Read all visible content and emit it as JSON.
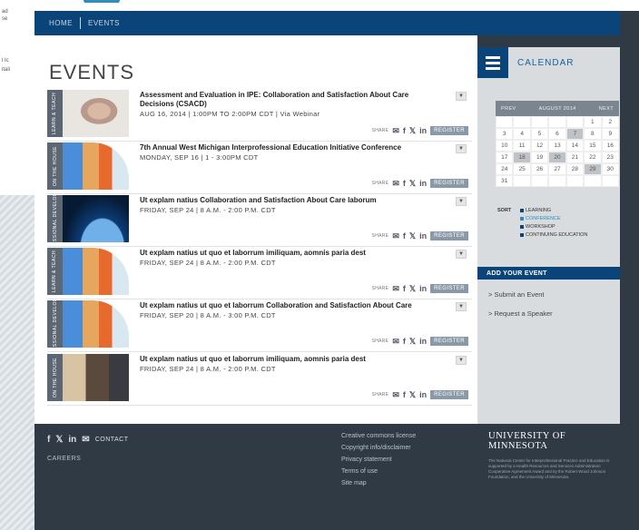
{
  "nav": {
    "items": [
      "HOME",
      "EVENTS"
    ]
  },
  "left_panel": {
    "lines": [
      "ad",
      "se",
      "l Ic",
      "itali"
    ]
  },
  "page": {
    "title": "EVENTS"
  },
  "share_label": "SHARE",
  "register_label": "REGISTER",
  "events": [
    {
      "band": "LEARN & TEACH",
      "image": "face",
      "title": "Assessment and Evaluation in IPE: Collaboration and Satisfaction About Care Decisions (CSACD)",
      "date": "AUG 16, 2014   |   1:00PM TO 2:00PM CDT   |   Via Webinar"
    },
    {
      "band": "ON THE HOUSE",
      "image": "arcs",
      "title": "7th Annual West Michigan Interprofessional Education Initiative Conference",
      "date": "MONDAY, SEP 16   |   1 - 3:00PM CDT"
    },
    {
      "band": "PROFESSIONAL DEVELOPMENT",
      "image": "earth",
      "title": "Ut explam natius Collaboration and Satisfaction About Care laborum",
      "date": "FRIDAY, SEP 24   |   8 A.M. - 2:00 P.M. CDT"
    },
    {
      "band": "LEARN & TEACH",
      "image": "arcs",
      "title": "Ut explam natius ut quo et laborrum imiliquam, aomnis paria dest",
      "date": "FRIDAY, SEP 24   |   8 A.M. - 2:00 P.M. CDT"
    },
    {
      "band": "PROFESSIONAL DEVELOPMENT",
      "image": "arcs",
      "title": "Ut explam natius ut quo et laborrum Collaboration and Satisfaction About Care",
      "date": "FRIDAY, SEP 20   |   8 A.M. - 3:00 P.M. CDT"
    },
    {
      "band": "ON THE HOUSE",
      "image": "people",
      "title": "Ut explam natius ut quo et laborrum imiliquam, aomnis paria dest",
      "date": "FRIDAY, SEP 24   |   8 A.M. - 2:00 P.M. CDT"
    }
  ],
  "calendar": {
    "title": "CALENDAR",
    "prev": "PREV",
    "month": "AUGUST 2014",
    "next": "NEXT",
    "days": [
      "",
      "",
      "",
      "",
      "",
      "1",
      "2",
      "3",
      "4",
      "5",
      "6",
      "7",
      "8",
      "9",
      "10",
      "11",
      "12",
      "13",
      "14",
      "15",
      "16",
      "17",
      "18",
      "19",
      "20",
      "21",
      "22",
      "23",
      "24",
      "25",
      "26",
      "27",
      "28",
      "29",
      "30",
      "31",
      "",
      "",
      "",
      "",
      "",
      ""
    ],
    "highlighted": [
      "7",
      "18",
      "20",
      "29"
    ],
    "legend_key": "SORT",
    "legend": [
      {
        "label": "LEARNING",
        "color": "#0a4478"
      },
      {
        "label": "CONFERENCE",
        "color": "#2a8fc0"
      },
      {
        "label": "WORKSHOP",
        "color": "#0a4478"
      },
      {
        "label": "CONTINUING EDUCATION",
        "color": "#0a4478"
      }
    ],
    "legend_colors": {
      "learning": "#0a4478",
      "conference": "#2a8fc0"
    }
  },
  "sidebar": {
    "add_event": "ADD YOUR EVENT",
    "links": [
      "> Submit an Event",
      "> Request a Speaker"
    ]
  },
  "footer": {
    "contact": "CONTACT",
    "careers": "CAREERS",
    "links": [
      "Creative commons license",
      "Copyright info/disclaimer",
      "Privacy statement",
      "Terms of use",
      "Site map"
    ],
    "university": "UNIVERSITY OF MINNESOTA",
    "disclaimer": "The National Center for Interprofessional Practice and Education is supported by a Health Resources and Services Administration Cooperative Agreement Award and by the Robert Wood Johnson Foundation, and the University of Minnesota."
  },
  "colors": {
    "brand": "#0a4478",
    "footer": "#2f3a45",
    "register": "#8a99a8"
  }
}
